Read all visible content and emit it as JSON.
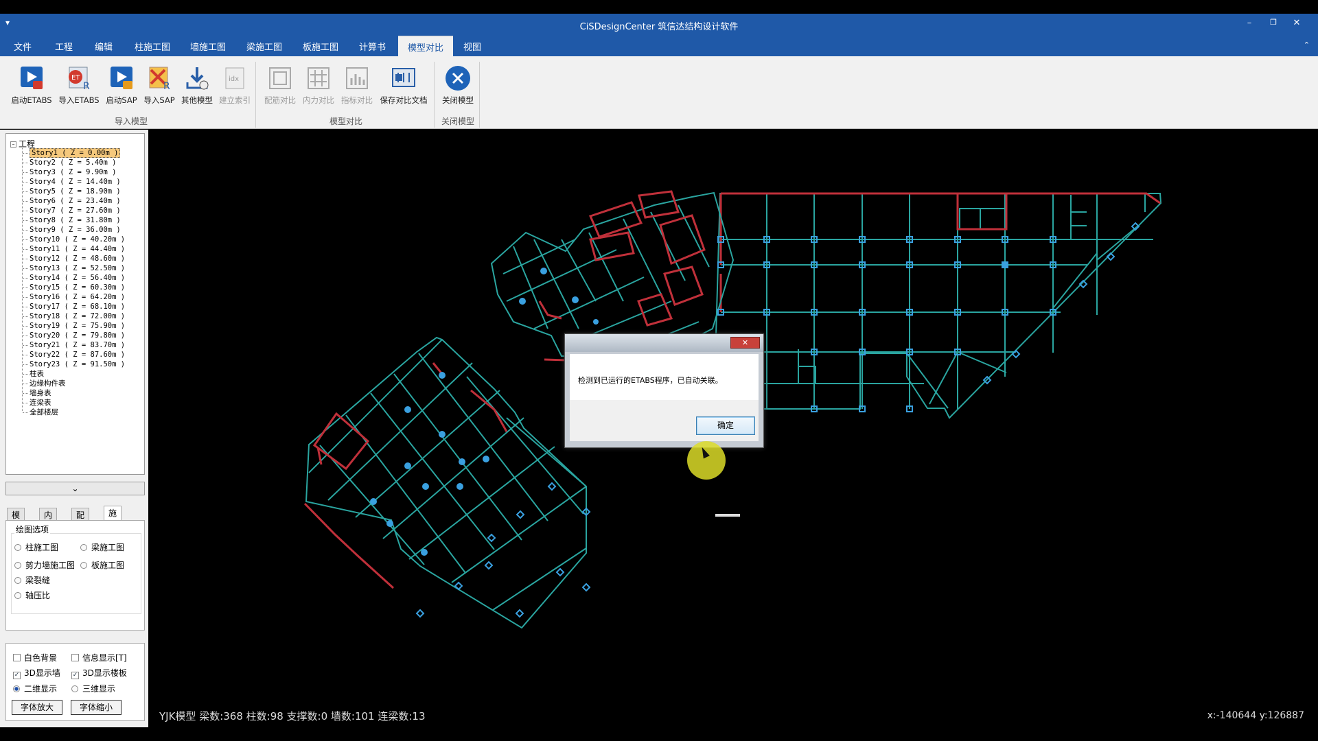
{
  "window": {
    "title": "CiSDesignCenter 筑信达结构设计软件",
    "quick_access": "▾",
    "min": "–",
    "restore": "❐",
    "close": "✕"
  },
  "menu": {
    "items": [
      "文件",
      "工程",
      "编辑",
      "柱施工图",
      "墙施工图",
      "梁施工图",
      "板施工图",
      "计算书",
      "模型对比",
      "视图"
    ],
    "active": "模型对比",
    "collapse": "⌃"
  },
  "ribbon": {
    "import_group": {
      "label": "导入模型",
      "buttons": [
        "启动ETABS",
        "导入ETABS",
        "启动SAP",
        "导入SAP",
        "其他模型",
        "建立索引"
      ]
    },
    "compare_group": {
      "label": "模型对比",
      "buttons": [
        "配筋对比",
        "内力对比",
        "指标对比",
        "保存对比文档"
      ]
    },
    "close_group": {
      "label": "关闭模型",
      "buttons": [
        "关闭模型"
      ]
    }
  },
  "tree": {
    "root": "工程",
    "root_toggle": "–",
    "stories": [
      "Story1 ( Z = 0.00m )",
      "Story2 ( Z = 5.40m )",
      "Story3 ( Z = 9.90m )",
      "Story4 ( Z = 14.40m )",
      "Story5 ( Z = 18.90m )",
      "Story6 ( Z = 23.40m )",
      "Story7 ( Z = 27.60m )",
      "Story8 ( Z = 31.80m )",
      "Story9 ( Z = 36.00m )",
      "Story10 ( Z = 40.20m )",
      "Story11 ( Z = 44.40m )",
      "Story12 ( Z = 48.60m )",
      "Story13 ( Z = 52.50m )",
      "Story14 ( Z = 56.40m )",
      "Story15 ( Z = 60.30m )",
      "Story16 ( Z = 64.20m )",
      "Story17 ( Z = 68.10m )",
      "Story18 ( Z = 72.00m )",
      "Story19 ( Z = 75.90m )",
      "Story20 ( Z = 79.80m )",
      "Story21 ( Z = 83.70m )",
      "Story22 ( Z = 87.60m )",
      "Story23 ( Z = 91.50m )"
    ],
    "selected_index": 0,
    "extras": [
      "柱表",
      "边缘构件表",
      "墙身表",
      "连梁表",
      "全部楼层"
    ]
  },
  "expander": "⌄",
  "tabs": {
    "items": [
      "模板",
      "内力",
      "配筋",
      "施工图"
    ],
    "active": "施工图"
  },
  "drawing_options": {
    "legend": "绘图选项",
    "options": [
      "柱施工图",
      "梁施工图",
      "剪力墙施工图",
      "板施工图",
      "梁裂缝",
      "轴压比"
    ]
  },
  "display": {
    "white_bg": {
      "label": "白色背景",
      "checked": false
    },
    "info_show": {
      "label": "信息显示[T]",
      "checked": false
    },
    "wall_3d": {
      "label": "3D显示墙",
      "checked": true
    },
    "slab_3d": {
      "label": "3D显示楼板",
      "checked": true
    },
    "view_2d": {
      "label": "二维显示",
      "selected": true
    },
    "view_3d": {
      "label": "三维显示",
      "selected": false
    },
    "font_up": "字体放大",
    "font_down": "字体缩小",
    "check_mark": "✓"
  },
  "status": {
    "left": "YJK模型  梁数:368 柱数:98 支撑数:0 墙数:101 连梁数:13",
    "coords": "x:-140644 y:126887"
  },
  "dialog": {
    "close": "✕",
    "message": "检测到已运行的ETABS程序，已自动关联。",
    "ok": "确定"
  },
  "colors": {
    "ribbon_blue": "#1f59a8",
    "beam": "#2aa5a0",
    "wall": "#c0303a",
    "column": "#3aa0e0"
  }
}
